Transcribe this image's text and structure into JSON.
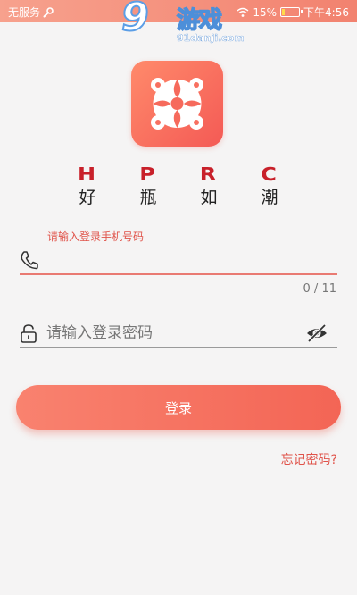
{
  "status_bar": {
    "carrier": "无服务",
    "battery": "15%",
    "battery_level": 0.15,
    "time": "下午4:56"
  },
  "watermark": {
    "number": "9",
    "brand": "游戏",
    "site": "91danji.com"
  },
  "brand": {
    "latin": [
      "H",
      "P",
      "R",
      "C"
    ],
    "chinese": [
      "好",
      "瓶",
      "如",
      "潮"
    ]
  },
  "login_form": {
    "phone_label": "请输入登录手机号码",
    "phone_value": "",
    "phone_counter": "0 / 11",
    "password_placeholder": "请输入登录密码",
    "password_value": "",
    "login_button": "登录",
    "forgot_link": "忘记密码?"
  },
  "colors": {
    "accent": "#f36555",
    "label": "#e0534a",
    "brand_latin": "#c8202a"
  },
  "icons": [
    "wrench-icon",
    "battery-icon",
    "phone-icon",
    "lock-icon",
    "eye-off-icon"
  ]
}
